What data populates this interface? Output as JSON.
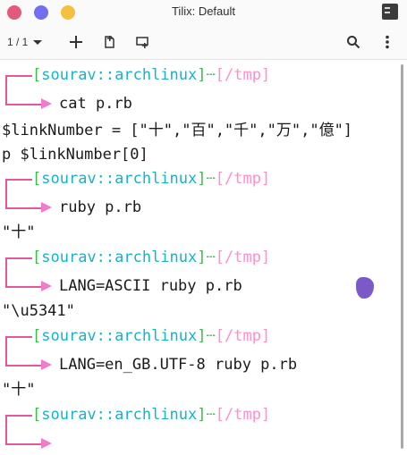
{
  "window": {
    "title": "Tilix: Default"
  },
  "toolbar": {
    "session_label": "1 / 1"
  },
  "icons": {
    "add": "plus-icon",
    "add_right": "add-terminal-right-icon",
    "add_down": "add-terminal-down-icon",
    "search": "search-icon",
    "menu": "kebab-menu-icon",
    "sidebar": "sidebar-toggle-icon"
  },
  "colors": {
    "close_button": "#e25a7a",
    "minimize_button": "#6f6ff0",
    "maximize_button": "#f3c13f",
    "prompt_bracket": "#3cb84e",
    "prompt_host": "#19b3c8",
    "prompt_path": "#ff8fcb",
    "prompt_corner": "#e2589a",
    "prompt_arrow": "#f17ccb"
  },
  "prompt": {
    "bracket_open": "[",
    "user_host": "sourav::archlinux",
    "bracket_close": "]",
    "separator": "┄",
    "path": "[/tmp]"
  },
  "terminal": {
    "blocks": [
      {
        "command": "cat p.rb",
        "output": [
          "$linkNumber = [\"十\",\"百\",\"千\",\"万\",\"億\"]",
          "p $linkNumber[0]"
        ]
      },
      {
        "command": "ruby p.rb",
        "output": [
          "\"十\""
        ]
      },
      {
        "command": "LANG=ASCII ruby p.rb",
        "output": [
          "\"\\u5341\""
        ]
      },
      {
        "command": "LANG=en_GB.UTF-8 ruby p.rb",
        "output": [
          "\"十\""
        ]
      },
      {
        "command": "",
        "output": []
      }
    ]
  }
}
